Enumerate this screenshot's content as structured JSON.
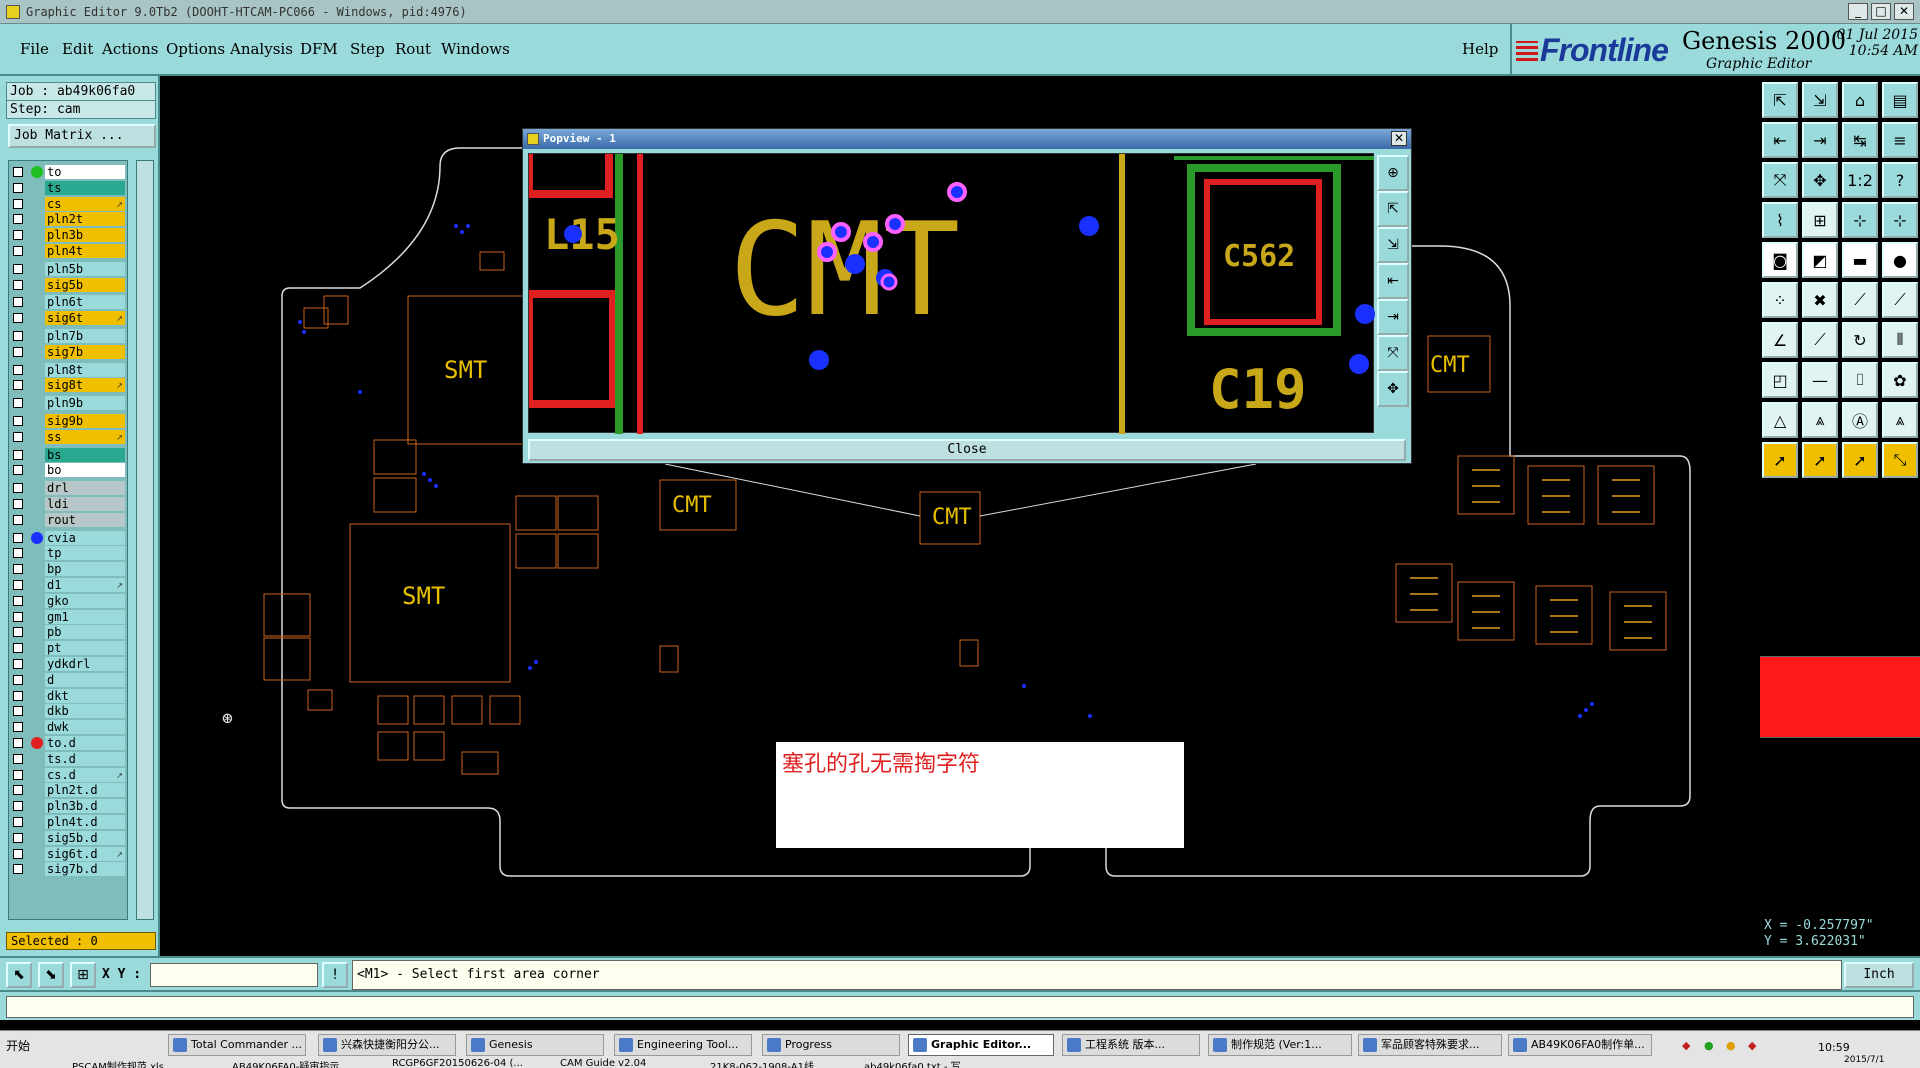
{
  "window": {
    "title": "Graphic Editor 9.0Tb2 (DOOHT-HTCAM-PC066 - Windows, pid:4976)"
  },
  "menu": {
    "items": [
      "File",
      "Edit",
      "Actions",
      "Options",
      "Analysis",
      "DFM",
      "Step",
      "Rout",
      "Windows"
    ],
    "help": "Help"
  },
  "brand": {
    "logo": "Frontline",
    "product": "Genesis 2000",
    "subtitle": "Graphic Editor",
    "date": "01 Jul 2015",
    "time": "10:54 AM"
  },
  "job": {
    "job_line": "Job : ab49k06fa0",
    "step_line": "Step: cam",
    "matrix_button": "Job Matrix ..."
  },
  "layers": [
    {
      "name": "to",
      "color": "#ffffff",
      "dot": "#20c020",
      "mark": ""
    },
    {
      "name": "ts",
      "color": "#2aa890",
      "dot": "",
      "mark": ""
    },
    {
      "name": "cs",
      "color": "#f0c000",
      "dot": "",
      "mark": "↗"
    },
    {
      "name": "pln2t",
      "color": "#f0c000",
      "dot": "",
      "mark": ""
    },
    {
      "name": "pln3b",
      "color": "#f0c000",
      "dot": "",
      "mark": ""
    },
    {
      "name": "pln4t",
      "color": "#f0c000",
      "dot": "",
      "mark": ""
    },
    {
      "name": "pln5b",
      "color": "#9adada",
      "dot": "",
      "mark": ""
    },
    {
      "name": "sig5b",
      "color": "#f0c000",
      "dot": "",
      "mark": ""
    },
    {
      "name": "pln6t",
      "color": "#9adada",
      "dot": "",
      "mark": ""
    },
    {
      "name": "sig6t",
      "color": "#f0c000",
      "dot": "",
      "mark": "↗"
    },
    {
      "name": "pln7b",
      "color": "#9adada",
      "dot": "",
      "mark": ""
    },
    {
      "name": "sig7b",
      "color": "#f0c000",
      "dot": "",
      "mark": ""
    },
    {
      "name": "pln8t",
      "color": "#9adada",
      "dot": "",
      "mark": ""
    },
    {
      "name": "sig8t",
      "color": "#f0c000",
      "dot": "",
      "mark": "↗"
    },
    {
      "name": "pln9b",
      "color": "#9adada",
      "dot": "",
      "mark": ""
    },
    {
      "name": "sig9b",
      "color": "#f0c000",
      "dot": "",
      "mark": ""
    },
    {
      "name": "ss",
      "color": "#f0c000",
      "dot": "",
      "mark": "↗"
    },
    {
      "name": "bs",
      "color": "#2aa890",
      "dot": "",
      "mark": ""
    },
    {
      "name": "bo",
      "color": "#ffffff",
      "dot": "",
      "mark": ""
    },
    {
      "name": "drl",
      "color": "#b8c8c8",
      "dot": "",
      "mark": ""
    },
    {
      "name": "ldi",
      "color": "#b8c8c8",
      "dot": "",
      "mark": ""
    },
    {
      "name": "rout",
      "color": "#b8c8c8",
      "dot": "",
      "mark": ""
    },
    {
      "name": "cvia",
      "color": "#9adada",
      "dot": "#1a30ff",
      "mark": ""
    },
    {
      "name": "tp",
      "color": "#9adada",
      "dot": "",
      "mark": ""
    },
    {
      "name": "bp",
      "color": "#9adada",
      "dot": "",
      "mark": ""
    },
    {
      "name": "d1",
      "color": "#9adada",
      "dot": "",
      "mark": "↗"
    },
    {
      "name": "gko",
      "color": "#9adada",
      "dot": "",
      "mark": ""
    },
    {
      "name": "gm1",
      "color": "#9adada",
      "dot": "",
      "mark": ""
    },
    {
      "name": "pb",
      "color": "#9adada",
      "dot": "",
      "mark": ""
    },
    {
      "name": "pt",
      "color": "#9adada",
      "dot": "",
      "mark": ""
    },
    {
      "name": "ydkdrl",
      "color": "#9adada",
      "dot": "",
      "mark": ""
    },
    {
      "name": "d",
      "color": "#9adada",
      "dot": "",
      "mark": ""
    },
    {
      "name": "dkt",
      "color": "#9adada",
      "dot": "",
      "mark": ""
    },
    {
      "name": "dkb",
      "color": "#9adada",
      "dot": "",
      "mark": ""
    },
    {
      "name": "dwk",
      "color": "#9adada",
      "dot": "",
      "mark": ""
    },
    {
      "name": "to.d",
      "color": "#9adada",
      "dot": "#e02020",
      "mark": ""
    },
    {
      "name": "ts.d",
      "color": "#9adada",
      "dot": "",
      "mark": ""
    },
    {
      "name": "cs.d",
      "color": "#9adada",
      "dot": "",
      "mark": "↗"
    },
    {
      "name": "pln2t.d",
      "color": "#9adada",
      "dot": "",
      "mark": ""
    },
    {
      "name": "pln3b.d",
      "color": "#9adada",
      "dot": "",
      "mark": ""
    },
    {
      "name": "pln4t.d",
      "color": "#9adada",
      "dot": "",
      "mark": ""
    },
    {
      "name": "sig5b.d",
      "color": "#9adada",
      "dot": "",
      "mark": ""
    },
    {
      "name": "sig6t.d",
      "color": "#9adada",
      "dot": "",
      "mark": "↗"
    },
    {
      "name": "sig7b.d",
      "color": "#9adada",
      "dot": "",
      "mark": ""
    }
  ],
  "selected_count": "Selected : 0",
  "coords": {
    "x": "X = -0.257797\"",
    "y": "Y = 3.622031\""
  },
  "status": {
    "xy_label": "X Y :",
    "prompt": "<M1> - Select first area corner",
    "units": "Inch"
  },
  "popview": {
    "title": "Popview - 1",
    "close_label": "Close"
  },
  "pcb_labels": {
    "cmt": "CMT",
    "smt": "SMT",
    "l15": "L15",
    "c562": "C562",
    "c19": "C19"
  },
  "note": "塞孔的孔无需掏字符",
  "taskbar": {
    "start": "开始",
    "tasks": [
      "Total Commander ...",
      "兴森快捷衡阳分公...",
      "Genesis",
      "Engineering Tool...",
      "Progress",
      "Graphic Editor...",
      "工程系统  版本...",
      "制作规范 (Ver:1...",
      "军品顾客特殊要求...",
      "AB49K06FA0制作单..."
    ],
    "row2": [
      "PSCAM制作规范.xls",
      "AB49K06FA0-疑审指示...",
      "RCGP6GF20150626-04 (...",
      "CAM Guide v2.04",
      "21K8-062-1908-A1线...",
      "ab49k06fa0.txt - 写..."
    ],
    "clock_time": "10:59",
    "clock_date": "2015/7/1"
  }
}
